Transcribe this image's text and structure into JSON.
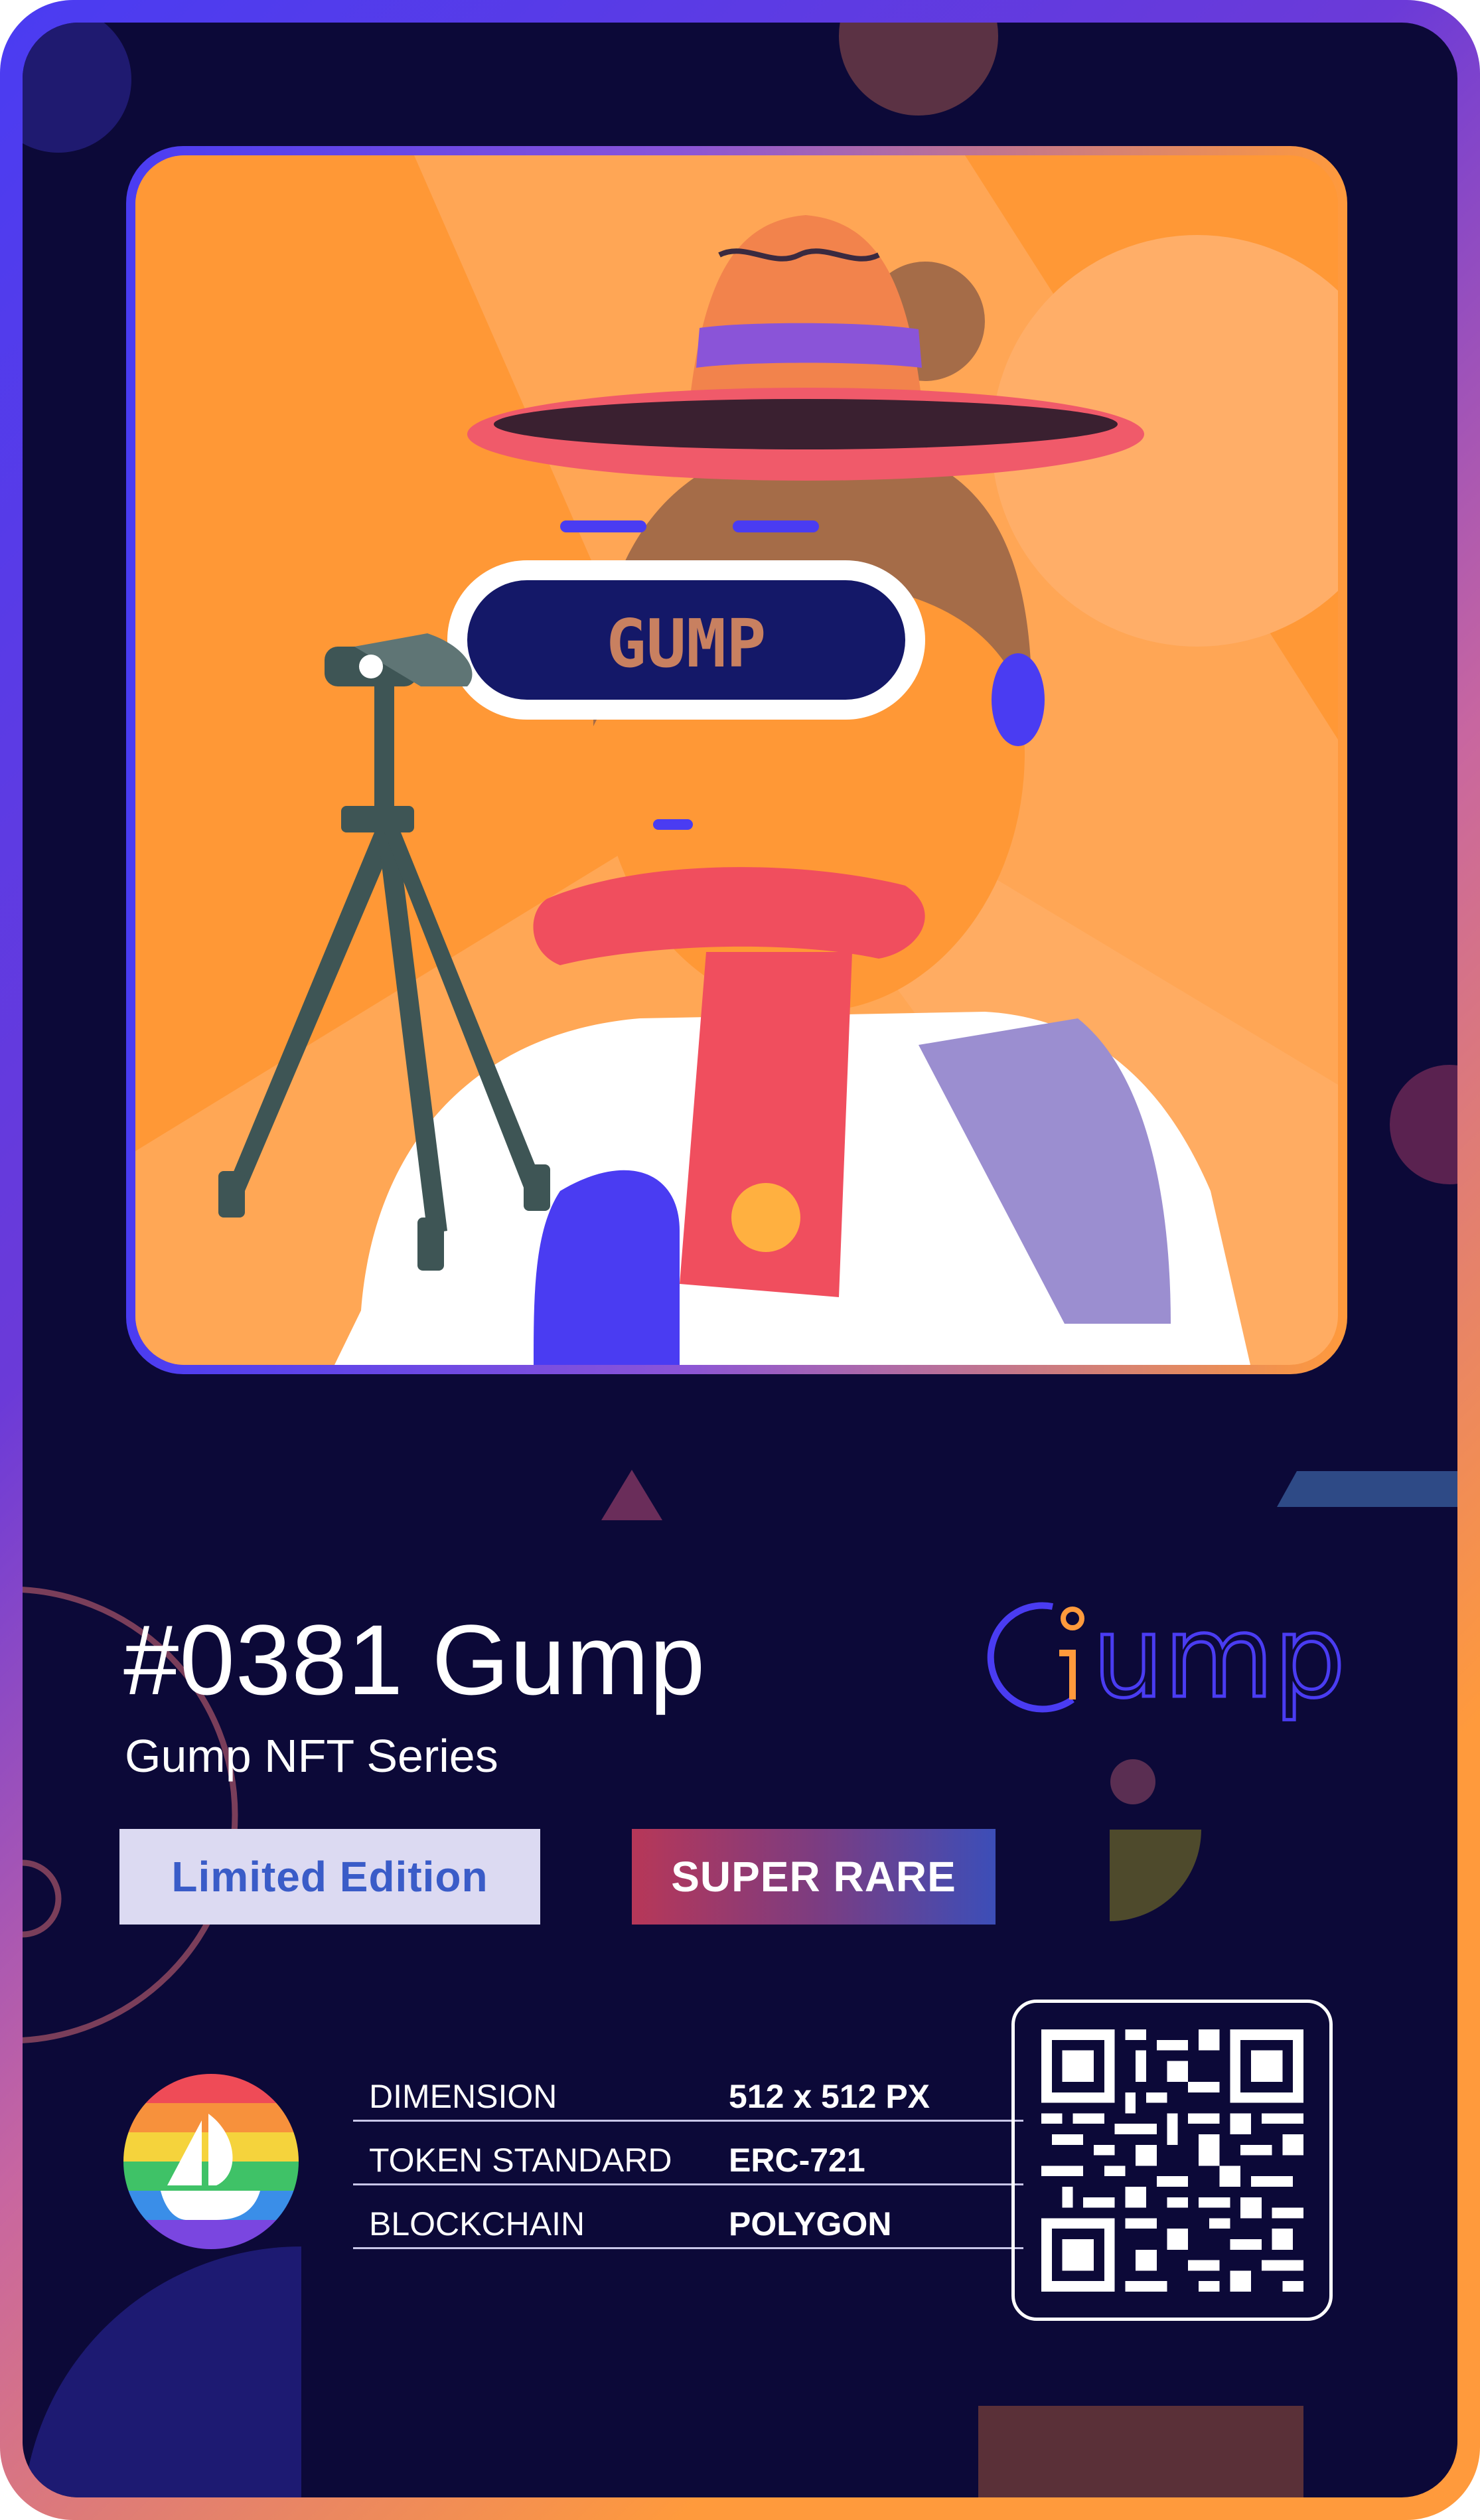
{
  "nft": {
    "title": "#0381 Gump",
    "series": "Gump NFT Series",
    "badges": {
      "edition": "Limited Edition",
      "rarity": "SUPER RARE"
    },
    "brand_wordmark": "Gump",
    "artwork_text": "GUMP"
  },
  "specs": [
    {
      "label": "DIMENSION",
      "value": "512 x 512 PX"
    },
    {
      "label": "TOKEN STANDARD",
      "value": "ERC-721"
    },
    {
      "label": "BLOCKCHAIN",
      "value": "POLYGON"
    }
  ],
  "icons": {
    "marketplace": "opensea-icon",
    "qr": "qr-code-icon",
    "brand": "gump-logo-icon"
  },
  "colors": {
    "card_background": "#0c0938",
    "accent_orange": "#ff9a3c",
    "accent_blue": "#4a3cf2",
    "limited_badge_bg": "#dcdaf2",
    "limited_badge_text": "#3a5cc8",
    "rare_badge_start": "#b73758",
    "rare_badge_end": "#3c4eb8"
  }
}
